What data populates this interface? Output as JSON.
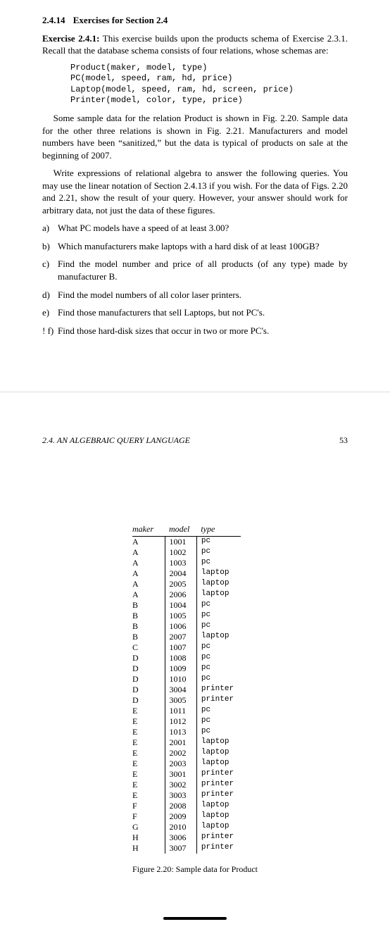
{
  "section": {
    "number": "2.4.14",
    "title": "Exercises for Section 2.4"
  },
  "exercise": {
    "label": "Exercise 2.4.1:",
    "intro": "This exercise builds upon the products schema of Exercise 2.3.1. Recall that the database schema consists of four relations, whose schemas are:"
  },
  "schemas": [
    "Product(maker, model, type)",
    "PC(model, speed, ram, hd, price)",
    "Laptop(model, speed, ram, hd, screen, price)",
    "Printer(model, color, type, price)"
  ],
  "para1": "Some sample data for the relation Product is shown in Fig. 2.20. Sample data for the other three relations is shown in Fig. 2.21. Manufacturers and model numbers have been “sanitized,” but the data is typical of products on sale at the beginning of 2007.",
  "para2": "Write expressions of relational algebra to answer the following queries. You may use the linear notation of Section 2.4.13 if you wish. For the data of Figs. 2.20 and 2.21, show the result of your query. However, your answer should work for arbitrary data, not just the data of these figures.",
  "questions": [
    {
      "marker": "a)",
      "text": "What PC models have a speed of at least 3.00?"
    },
    {
      "marker": "b)",
      "text": "Which manufacturers make laptops with a hard disk of at least 100GB?"
    },
    {
      "marker": "c)",
      "text": "Find the model number and price of all products (of any type) made by manufacturer B."
    },
    {
      "marker": "d)",
      "text": "Find the model numbers of all color laser printers."
    },
    {
      "marker": "e)",
      "text": "Find those manufacturers that sell Laptops, but not PC's."
    },
    {
      "marker": "! f)",
      "text": "Find those hard-disk sizes that occur in two or more PC's."
    }
  ],
  "page2": {
    "running_head": "2.4. AN ALGEBRAIC QUERY LANGUAGE",
    "page_number": "53"
  },
  "table": {
    "headers": [
      "maker",
      "model",
      "type"
    ],
    "rows": [
      [
        "A",
        "1001",
        "pc"
      ],
      [
        "A",
        "1002",
        "pc"
      ],
      [
        "A",
        "1003",
        "pc"
      ],
      [
        "A",
        "2004",
        "laptop"
      ],
      [
        "A",
        "2005",
        "laptop"
      ],
      [
        "A",
        "2006",
        "laptop"
      ],
      [
        "B",
        "1004",
        "pc"
      ],
      [
        "B",
        "1005",
        "pc"
      ],
      [
        "B",
        "1006",
        "pc"
      ],
      [
        "B",
        "2007",
        "laptop"
      ],
      [
        "C",
        "1007",
        "pc"
      ],
      [
        "D",
        "1008",
        "pc"
      ],
      [
        "D",
        "1009",
        "pc"
      ],
      [
        "D",
        "1010",
        "pc"
      ],
      [
        "D",
        "3004",
        "printer"
      ],
      [
        "D",
        "3005",
        "printer"
      ],
      [
        "E",
        "1011",
        "pc"
      ],
      [
        "E",
        "1012",
        "pc"
      ],
      [
        "E",
        "1013",
        "pc"
      ],
      [
        "E",
        "2001",
        "laptop"
      ],
      [
        "E",
        "2002",
        "laptop"
      ],
      [
        "E",
        "2003",
        "laptop"
      ],
      [
        "E",
        "3001",
        "printer"
      ],
      [
        "E",
        "3002",
        "printer"
      ],
      [
        "E",
        "3003",
        "printer"
      ],
      [
        "F",
        "2008",
        "laptop"
      ],
      [
        "F",
        "2009",
        "laptop"
      ],
      [
        "G",
        "2010",
        "laptop"
      ],
      [
        "H",
        "3006",
        "printer"
      ],
      [
        "H",
        "3007",
        "printer"
      ]
    ]
  },
  "figure_caption": "Figure 2.20: Sample data for Product"
}
